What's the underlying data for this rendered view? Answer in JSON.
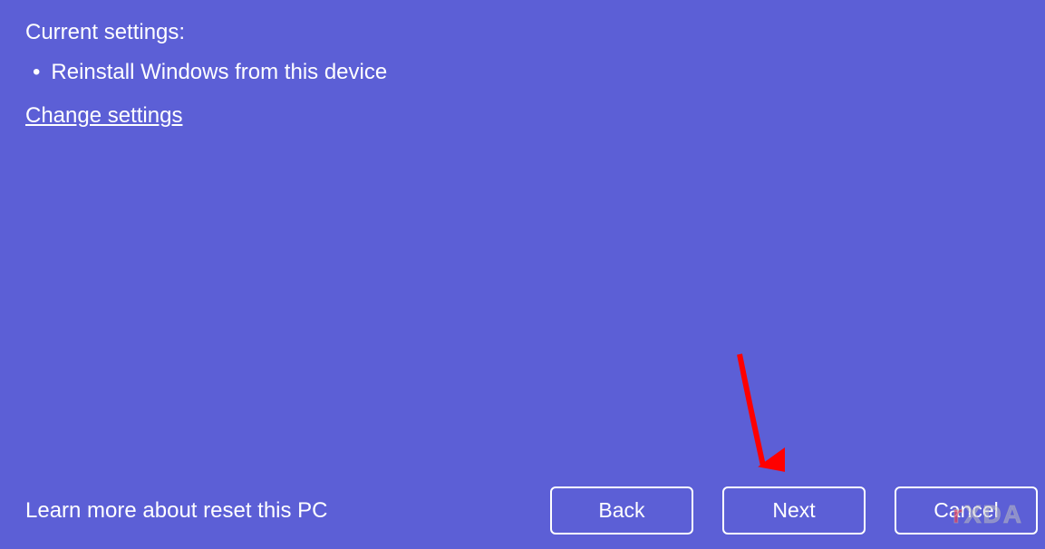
{
  "settings": {
    "heading": "Current settings:",
    "items": [
      "Reinstall Windows from this device"
    ],
    "change_link": "Change settings"
  },
  "footer": {
    "learn_more": "Learn more about reset this PC",
    "buttons": {
      "back": "Back",
      "next": "Next",
      "cancel": "Cancel"
    }
  },
  "watermark": {
    "prefix": "r",
    "text": "XDA"
  }
}
